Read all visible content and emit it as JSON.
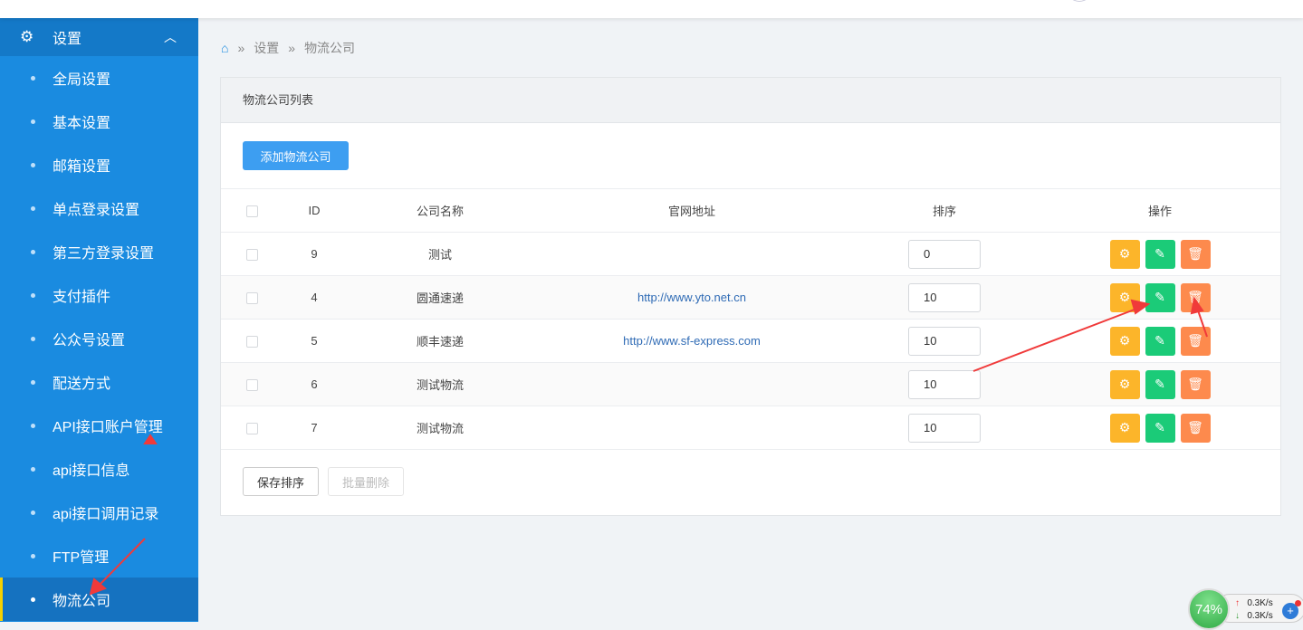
{
  "sidebar": {
    "section": "设置",
    "items": [
      "全局设置",
      "基本设置",
      "邮箱设置",
      "单点登录设置",
      "第三方登录设置",
      "支付插件",
      "公众号设置",
      "配送方式",
      "API接口账户管理",
      "api接口信息",
      "api接口调用记录",
      "FTP管理",
      "物流公司"
    ]
  },
  "breadcrumb": {
    "sep": "»",
    "items": [
      "设置",
      "物流公司"
    ]
  },
  "panel": {
    "title": "物流公司列表",
    "add_label": "添加物流公司",
    "save_sort_label": "保存排序",
    "batch_delete_label": "批量删除"
  },
  "table": {
    "headers": [
      "ID",
      "公司名称",
      "官网地址",
      "排序",
      "操作"
    ],
    "rows": [
      {
        "id": "9",
        "name": "测试",
        "url": "",
        "sort": "0"
      },
      {
        "id": "4",
        "name": "圆通速递",
        "url": "http://www.yto.net.cn",
        "sort": "10"
      },
      {
        "id": "5",
        "name": "顺丰速递",
        "url": "http://www.sf-express.com",
        "sort": "10"
      },
      {
        "id": "6",
        "name": "测试物流",
        "url": "",
        "sort": "10"
      },
      {
        "id": "7",
        "name": "测试物流",
        "url": "",
        "sort": "10"
      }
    ]
  },
  "netmon": {
    "percent": "74%",
    "up": "0.3K/s",
    "down": "0.3K/s"
  }
}
